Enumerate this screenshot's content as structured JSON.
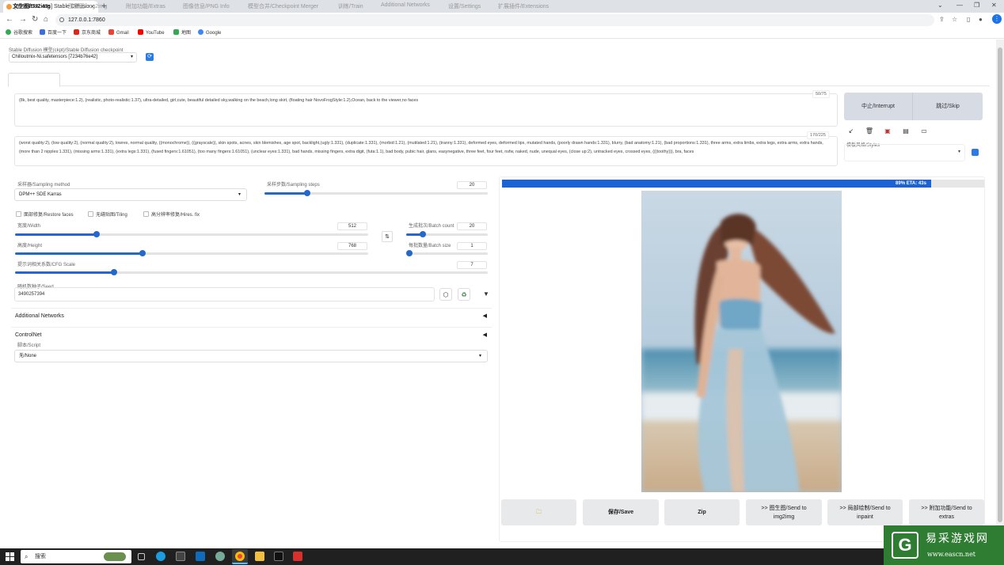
{
  "browser": {
    "tab_title": "[89% ETA: 43s] Stable Diffusio",
    "address": "127.0.0.1:7860",
    "bookmarks": [
      "谷歌搜索",
      "百度一下",
      "京东商城",
      "Gmail",
      "YouTube",
      "地图",
      "Google"
    ]
  },
  "header": {
    "checkpoint_label": "Stable Diffusion 模型(ckpt)/Stable Diffusion checkpoint",
    "checkpoint_value": "Chilloutmix-Ni.safetensors [7234b76e42]"
  },
  "tabs": [
    "文生图/txt2img",
    "图生图/img2img",
    "附加功能/Extras",
    "图像信息/PNG Info",
    "模型合并/Checkpoint Merger",
    "训练/Train",
    "Additional Networks",
    "设置/Settings",
    "扩展插件/Extensions"
  ],
  "prompt": {
    "text": "(8k, best quality, masterpiece:1.2), (realistic, photo-realistic:1.37), ultra-detailed,  girl,cute, beautiful detailed sky,walking on the beach,long skirt,  (floating hair NovoFrogStyle:1.2),Ocean, back to the viewer,no faces",
    "count": "50/75"
  },
  "negative": {
    "text": "(worst quality:2), (low quality:2), (normal quality:2), lowres, normal quality, ((monochrome)), ((grayscale)), skin spots, acnes, skin blemishes, age spot, backlight,(ugly:1.331), (duplicate:1.331), (morbid:1.21), (mutilated:1.21), (tranny:1.331), deformed eyes, deformed lips, mutated hands, (poorly drawn hands:1.331), blurry, (bad anatomy:1.21), (bad proportions:1.331), three arms, extra limbs, extra legs, extra arms, extra hands, (more than 2 nipples:1.331), (missing arms:1.331), (extra legs:1.331), (fused fingers:1.61051), (too many fingers:1.61051), (unclear eyes:1.331), bad hands, missing fingers, extra digit, (futa:1.1), bad body, pubic hair, glans, easynegative, three feet, four feet, nsfw, naked, nude, unequal eyes, (close up:2), untracked eyes, crossed eyes, (((toothy))), bra, faces",
    "count": "170/225"
  },
  "actions": {
    "interrupt": "中止/Interrupt",
    "skip": "跳过/Skip",
    "styles_label": "模板风格/Styles"
  },
  "params": {
    "sampler_label": "采样器/Sampling method",
    "sampler_value": "DPM++ SDE Karras",
    "steps_label": "采样步数/Sampling steps",
    "steps_value": "20",
    "steps_frac": 0.19,
    "restore_faces": "面部修复/Restore faces",
    "tiling": "无缝贴图/Tiling",
    "hires_fix": "高分辨率修复/Hires. fix",
    "width_label": "宽度/Width",
    "width_value": "512",
    "width_frac": 0.23,
    "height_label": "高度/Height",
    "height_value": "768",
    "height_frac": 0.36,
    "batch_count_label": "生成批次/Batch count",
    "batch_count_value": "20",
    "batch_count_frac": 0.2,
    "batch_size_label": "每批数量/Batch size",
    "batch_size_value": "1",
    "batch_size_frac": 0.0,
    "cfg_label": "提示词相关系数/CFG Scale",
    "cfg_value": "7",
    "cfg_frac": 0.21,
    "seed_label": "随机数种子/Seed",
    "seed_value": "3490257394"
  },
  "accordions": {
    "additional_networks": "Additional Networks",
    "controlnet": "ControlNet",
    "script_label": "脚本/Script",
    "script_value": "无/None"
  },
  "progress": {
    "text": "89% ETA: 43s",
    "frac": 0.89
  },
  "output_buttons": {
    "save": "保存/Save",
    "zip": "Zip",
    "img2img": ">> 图生图/Send to img2img",
    "inpaint": ">> 局部绘制/Send to inpaint",
    "extras": ">> 附加功能/Send to extras"
  },
  "taskbar": {
    "search": "搜索"
  },
  "watermark": {
    "title": "易采游戏网",
    "url": "www.eascn.net"
  },
  "colors": {
    "accent": "#2468cc",
    "progress": "#1a63d6"
  }
}
